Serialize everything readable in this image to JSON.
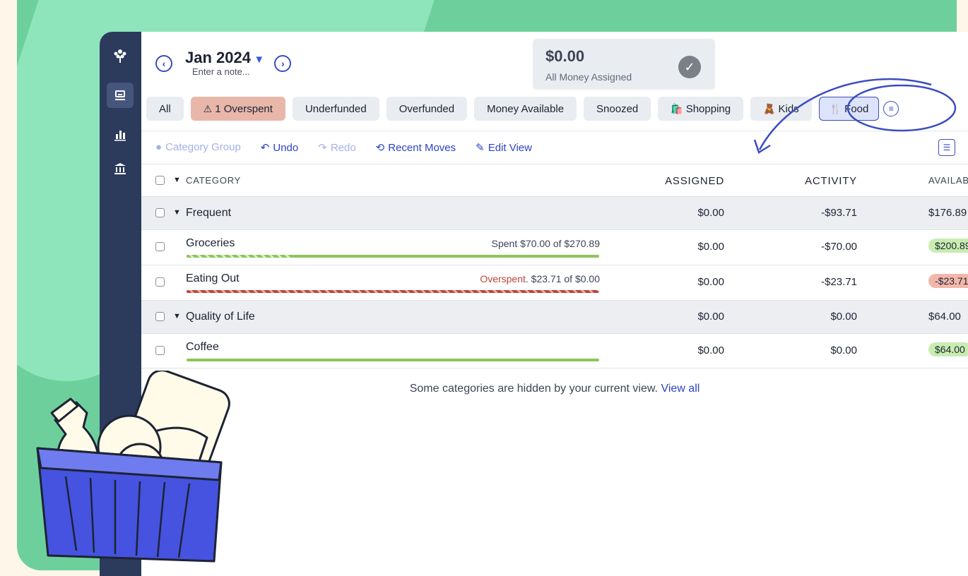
{
  "header": {
    "month": "Jan 2024",
    "note_placeholder": "Enter a note...",
    "assigned_amount": "$0.00",
    "assigned_label": "All Money Assigned"
  },
  "filters": [
    {
      "label": "All"
    },
    {
      "label": "1 Overspent",
      "icon": "warning-icon"
    },
    {
      "label": "Underfunded"
    },
    {
      "label": "Overfunded"
    },
    {
      "label": "Money Available"
    },
    {
      "label": "Snoozed"
    },
    {
      "label": "Shopping",
      "emoji": "🛍️"
    },
    {
      "label": "Kids",
      "emoji": "🧸"
    },
    {
      "label": "Food",
      "emoji": "🍴"
    }
  ],
  "toolbar": {
    "category_group": "Category Group",
    "undo": "Undo",
    "redo": "Redo",
    "recent_moves": "Recent Moves",
    "edit_view": "Edit View"
  },
  "columns": {
    "category": "CATEGORY",
    "assigned": "ASSIGNED",
    "activity": "ACTIVITY",
    "available": "AVAILABLE"
  },
  "groups": [
    {
      "name": "Frequent",
      "assigned": "$0.00",
      "activity": "-$93.71",
      "available": "$176.89",
      "categories": [
        {
          "name": "Groceries",
          "spent": "Spent $70.00 of $270.89",
          "assigned": "$0.00",
          "activity": "-$70.00",
          "available": "$200.89",
          "progress": 0.26
        },
        {
          "name": "Eating Out",
          "spent_prefix": "Overspent",
          "spent": ". $23.71 of $0.00",
          "assigned": "$0.00",
          "activity": "-$23.71",
          "available": "-$23.71",
          "progress": 1.0
        }
      ]
    },
    {
      "name": "Quality of Life",
      "assigned": "$0.00",
      "activity": "$0.00",
      "available": "$64.00",
      "categories": [
        {
          "name": "Coffee",
          "assigned": "$0.00",
          "activity": "$0.00",
          "available": "$64.00",
          "progress": 1.0
        }
      ]
    }
  ],
  "footer": {
    "hidden_text": "Some categories are hidden by your current view.",
    "view_all": "View all"
  },
  "colors": {
    "accent": "#3b4cc0",
    "sidebar": "#2c3a5c",
    "background_green": "#6dd09c",
    "overspent_chip": "#e8b7a9",
    "available_green": "#c8edb0",
    "available_red": "#f2b7aa"
  }
}
